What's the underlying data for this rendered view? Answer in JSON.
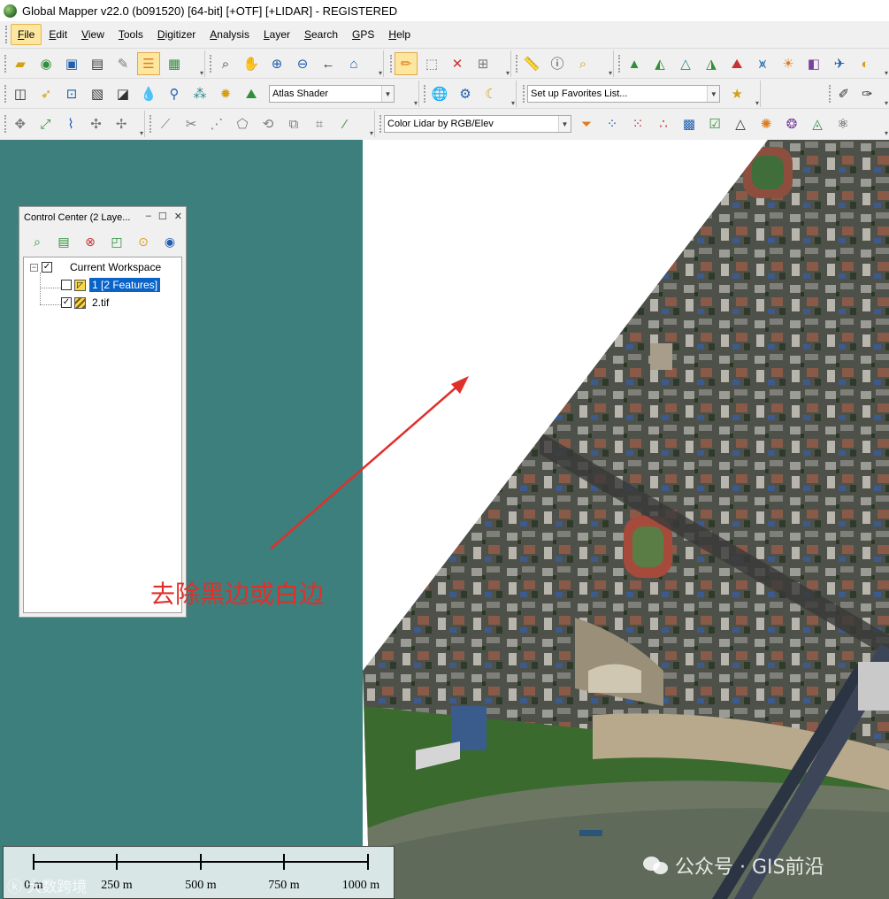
{
  "titlebar": {
    "title": "Global Mapper v22.0 (b091520) [64-bit] [+OTF] [+LIDAR] - REGISTERED"
  },
  "menu": {
    "items": [
      {
        "label": "File",
        "underline": "F",
        "rest": "ile"
      },
      {
        "label": "Edit",
        "underline": "E",
        "rest": "dit"
      },
      {
        "label": "View",
        "underline": "V",
        "rest": "iew"
      },
      {
        "label": "Tools",
        "underline": "T",
        "rest": "ools"
      },
      {
        "label": "Digitizer",
        "underline": "D",
        "rest": "igitizer"
      },
      {
        "label": "Analysis",
        "underline": "A",
        "rest": "nalysis"
      },
      {
        "label": "Layer",
        "underline": "L",
        "rest": "ayer"
      },
      {
        "label": "Search",
        "underline": "S",
        "rest": "earch"
      },
      {
        "label": "GPS",
        "underline": "G",
        "rest": "PS"
      },
      {
        "label": "Help",
        "underline": "H",
        "rest": "elp"
      }
    ]
  },
  "toolbar": {
    "shader_combo": "Atlas Shader",
    "favorites_combo": "Set up Favorites List...",
    "lidar_combo": "Color Lidar by RGB/Elev"
  },
  "control_center": {
    "title": "Control Center (2 Laye...",
    "tree": {
      "root": "Current Workspace",
      "layers": [
        {
          "label": "1 [2 Features]",
          "checked": false,
          "selected": true,
          "kind": "vector"
        },
        {
          "label": "2.tif",
          "checked": true,
          "selected": false,
          "kind": "raster"
        }
      ]
    }
  },
  "annotation": {
    "text": "去除黑边或白边",
    "color": "#e0302a"
  },
  "scalebar": {
    "labels": [
      "0 m",
      "250 m",
      "500 m",
      "750 m",
      "1000 m"
    ]
  },
  "watermarks": {
    "left": "大数跨境",
    "right": "公众号 · GIS前沿"
  },
  "colors": {
    "workspace_bg": "#3d7f7d",
    "map_bg": "#ffffff",
    "selection": "#0a64c8",
    "menu_active": "#fde7a0"
  }
}
